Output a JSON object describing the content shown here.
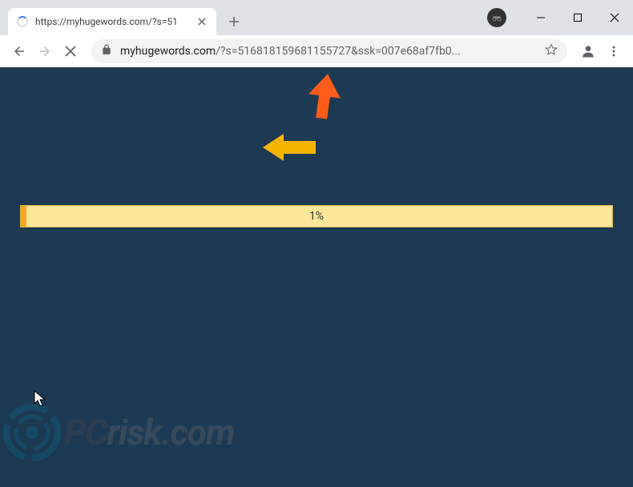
{
  "tab": {
    "title": "https://myhugewords.com/?s=51"
  },
  "toolbar": {
    "url_domain": "myhugewords.com",
    "url_path": "/?s=516818159681155727&ssk=007e68af7fb0..."
  },
  "page": {
    "progress_percent": "1%",
    "progress_width": "1%"
  },
  "watermark": {
    "text_pc": "PC",
    "text_risk": "risk.com"
  },
  "colors": {
    "page_bg": "#1e3a52",
    "progress_bg": "#fce79a",
    "progress_fill": "#f5a623",
    "arrow_orange": "#ff5c1a",
    "arrow_yellow": "#f5b400"
  }
}
